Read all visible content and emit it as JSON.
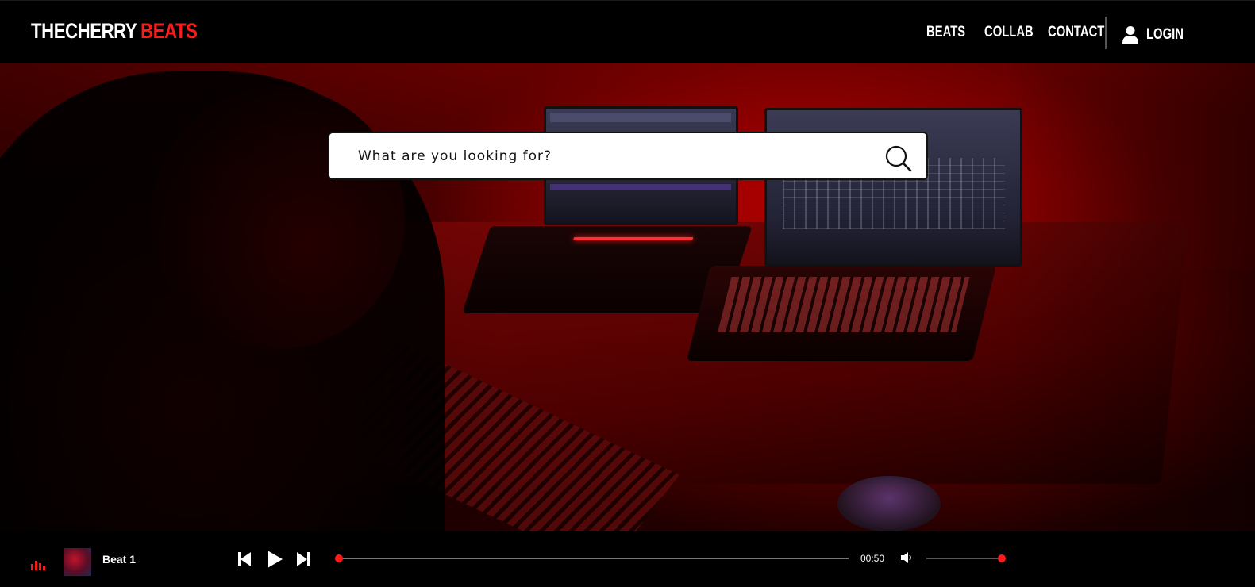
{
  "header": {
    "logo_part1": "THECHERRY",
    "logo_part2": "BEATS",
    "nav": [
      {
        "label": "BEATS"
      },
      {
        "label": "COLLAB"
      },
      {
        "label": "CONTACT"
      }
    ],
    "login_label": "LOGIN"
  },
  "search": {
    "placeholder": "What are you looking for?",
    "value": ""
  },
  "player": {
    "track_title": "Beat 1",
    "time": "00:50",
    "progress": 0,
    "volume": 1
  },
  "icons": {
    "search": "search-icon",
    "user": "user-icon",
    "equalizer": "equalizer-icon",
    "previous": "skip-previous-icon",
    "play": "play-icon",
    "next": "skip-next-icon",
    "volume": "volume-icon"
  },
  "colors": {
    "accent": "#ff1a1a",
    "background": "#000000",
    "hero_red": "#8a0000"
  }
}
